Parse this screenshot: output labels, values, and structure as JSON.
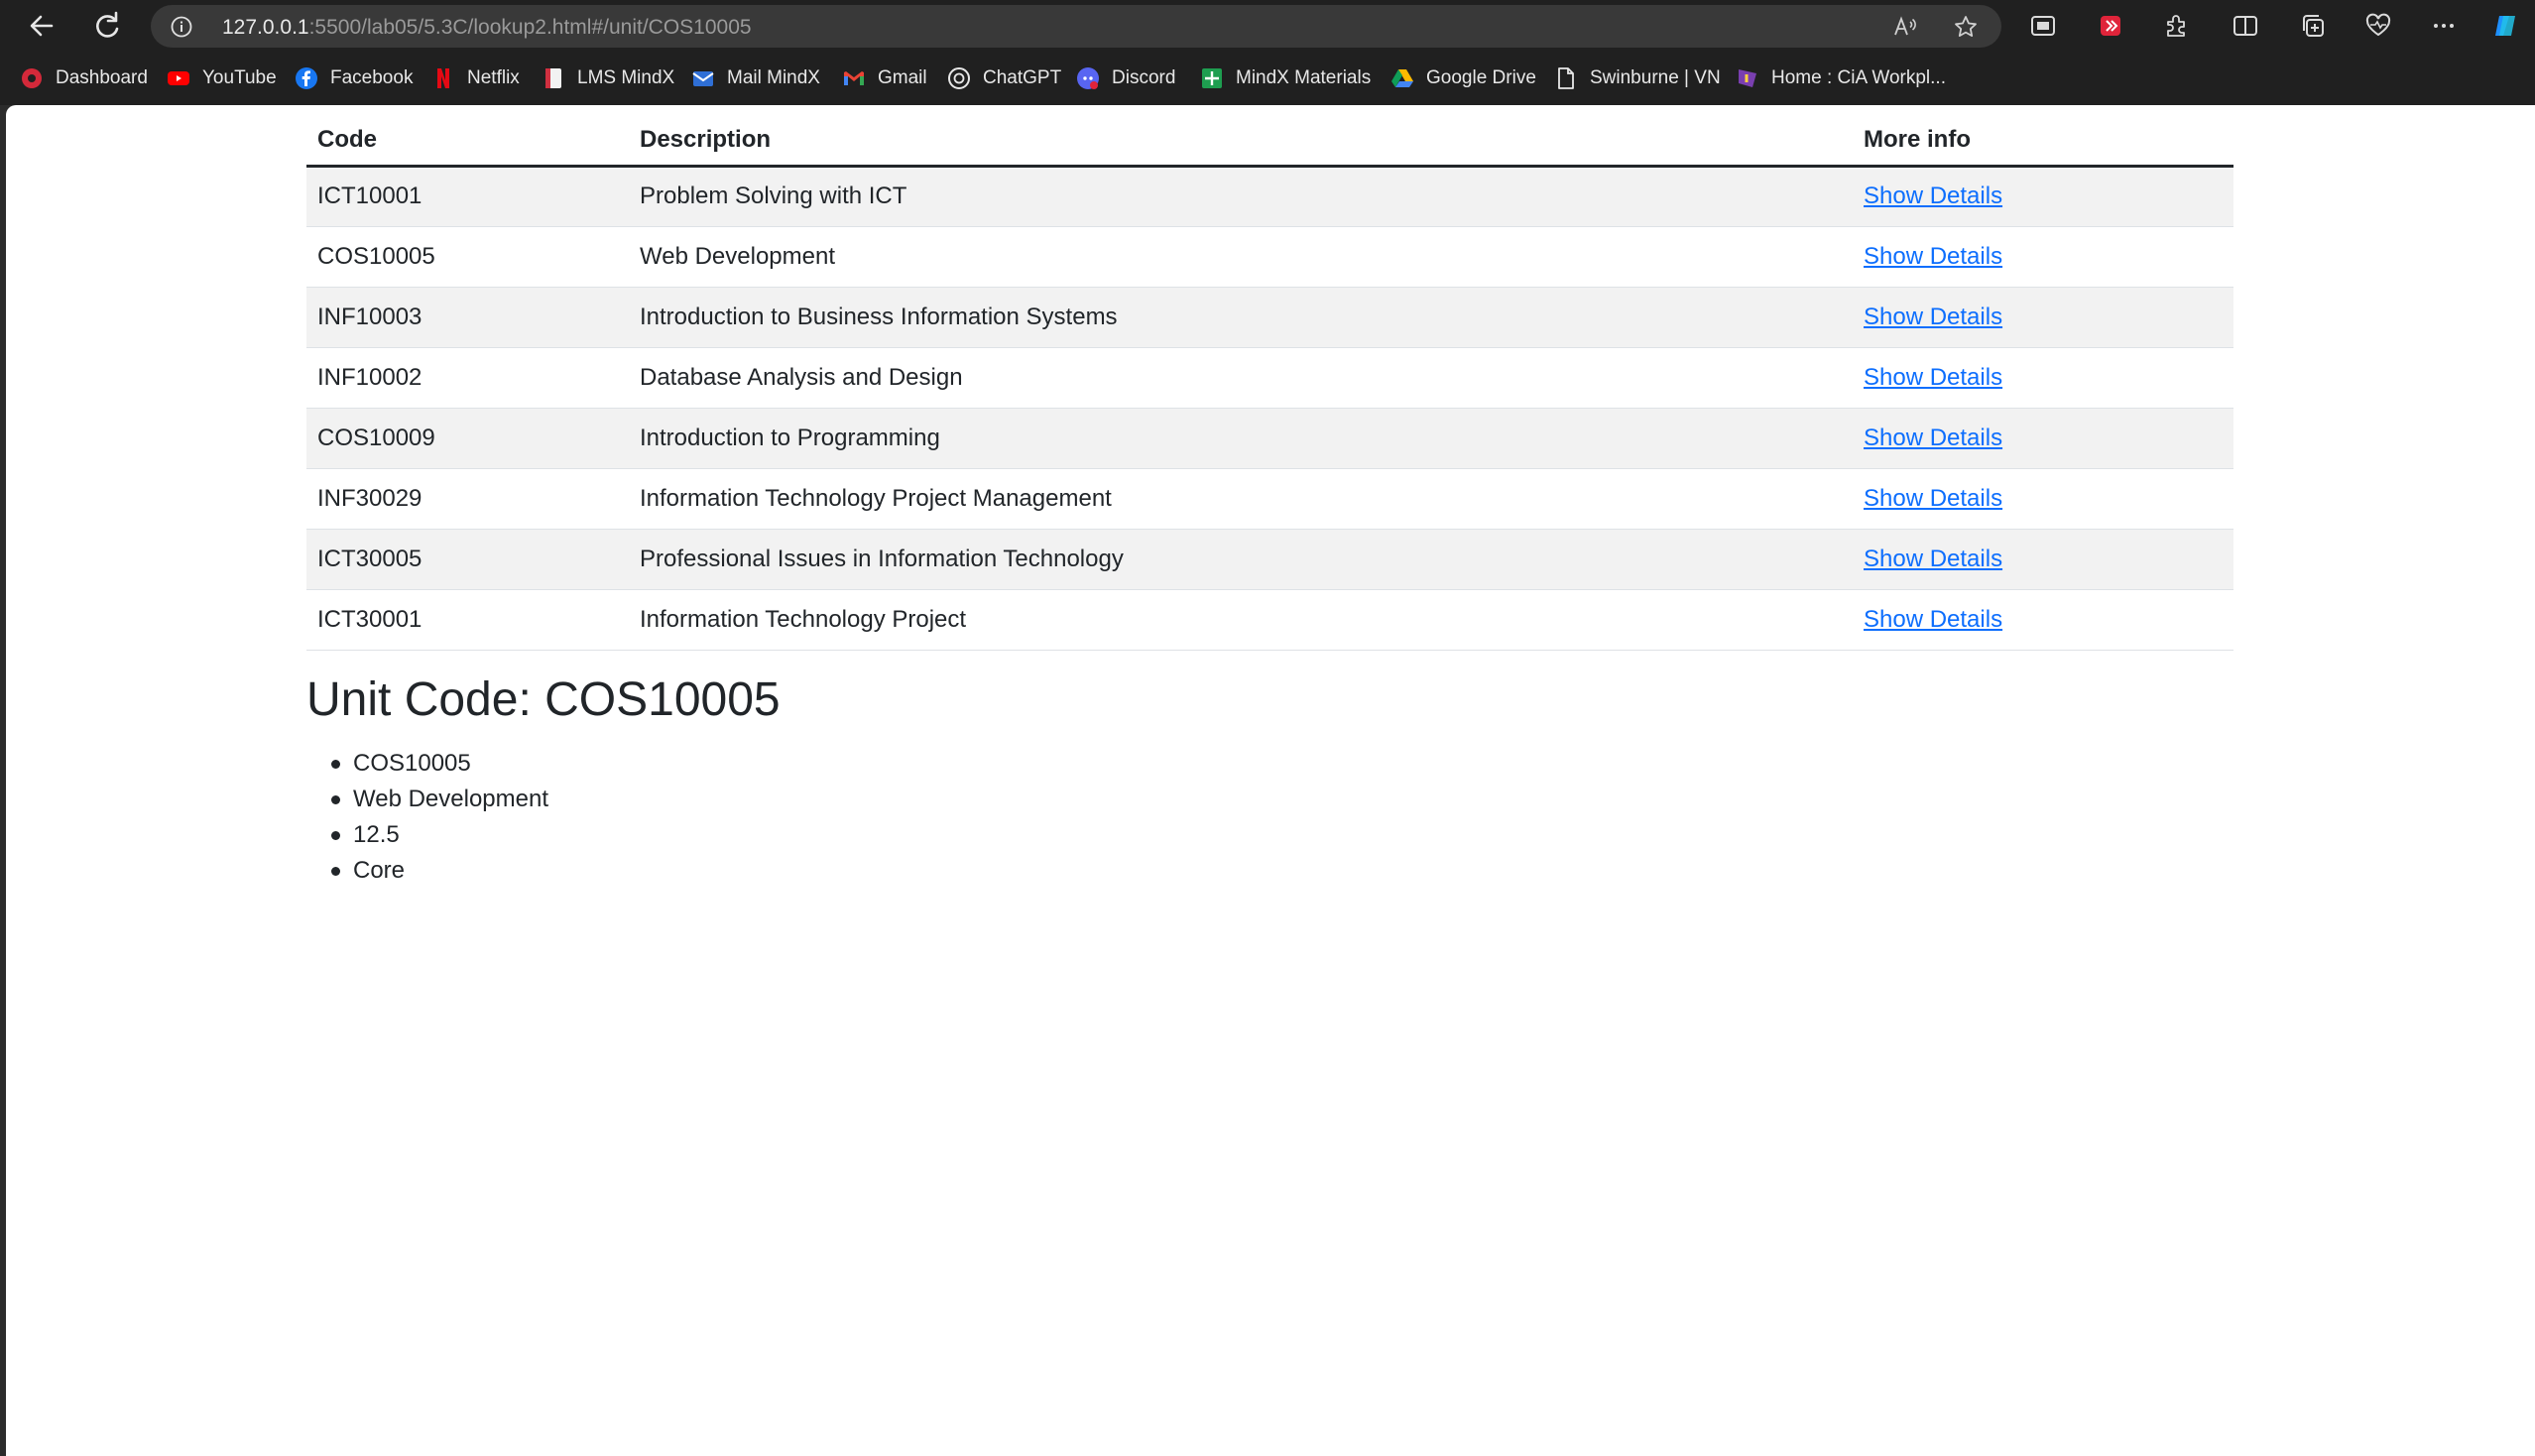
{
  "browser": {
    "url_host": "127.0.0.1",
    "url_rest": ":5500/lab05/5.3C/lookup2.html#/unit/COS10005",
    "bookmarks": [
      {
        "label": "Dashboard",
        "icon": "dashboard-icon"
      },
      {
        "label": "YouTube",
        "icon": "youtube-icon"
      },
      {
        "label": "Facebook",
        "icon": "facebook-icon"
      },
      {
        "label": "Netflix",
        "icon": "netflix-icon"
      },
      {
        "label": "LMS MindX",
        "icon": "lms-icon"
      },
      {
        "label": "Mail MindX",
        "icon": "mail-icon"
      },
      {
        "label": "Gmail",
        "icon": "gmail-icon"
      },
      {
        "label": "ChatGPT",
        "icon": "chatgpt-icon"
      },
      {
        "label": "Discord",
        "icon": "discord-icon"
      },
      {
        "label": "MindX Materials",
        "icon": "sheets-icon"
      },
      {
        "label": "Google Drive",
        "icon": "google-drive-icon"
      },
      {
        "label": "Swinburne | VN",
        "icon": "page-icon"
      },
      {
        "label": "Home : CiA Workpl...",
        "icon": "cia-icon"
      }
    ]
  },
  "table": {
    "headers": {
      "code": "Code",
      "description": "Description",
      "more": "More info"
    },
    "rows": [
      {
        "code": "ICT10001",
        "description": "Problem Solving with ICT",
        "link": "Show Details"
      },
      {
        "code": "COS10005",
        "description": "Web Development",
        "link": "Show Details"
      },
      {
        "code": "INF10003",
        "description": "Introduction to Business Information Systems",
        "link": "Show Details"
      },
      {
        "code": "INF10002",
        "description": "Database Analysis and Design",
        "link": "Show Details"
      },
      {
        "code": "COS10009",
        "description": "Introduction to Programming",
        "link": "Show Details"
      },
      {
        "code": "INF30029",
        "description": "Information Technology Project Management",
        "link": "Show Details"
      },
      {
        "code": "ICT30005",
        "description": "Professional Issues in Information Technology",
        "link": "Show Details"
      },
      {
        "code": "ICT30001",
        "description": "Information Technology Project",
        "link": "Show Details"
      }
    ]
  },
  "detail": {
    "title": "Unit Code: COS10005",
    "items": [
      "COS10005",
      "Web Development",
      "12.5",
      "Core"
    ]
  },
  "colors": {
    "link": "#0d6efd",
    "stripe": "#f2f2f2",
    "chrome": "#202020"
  }
}
